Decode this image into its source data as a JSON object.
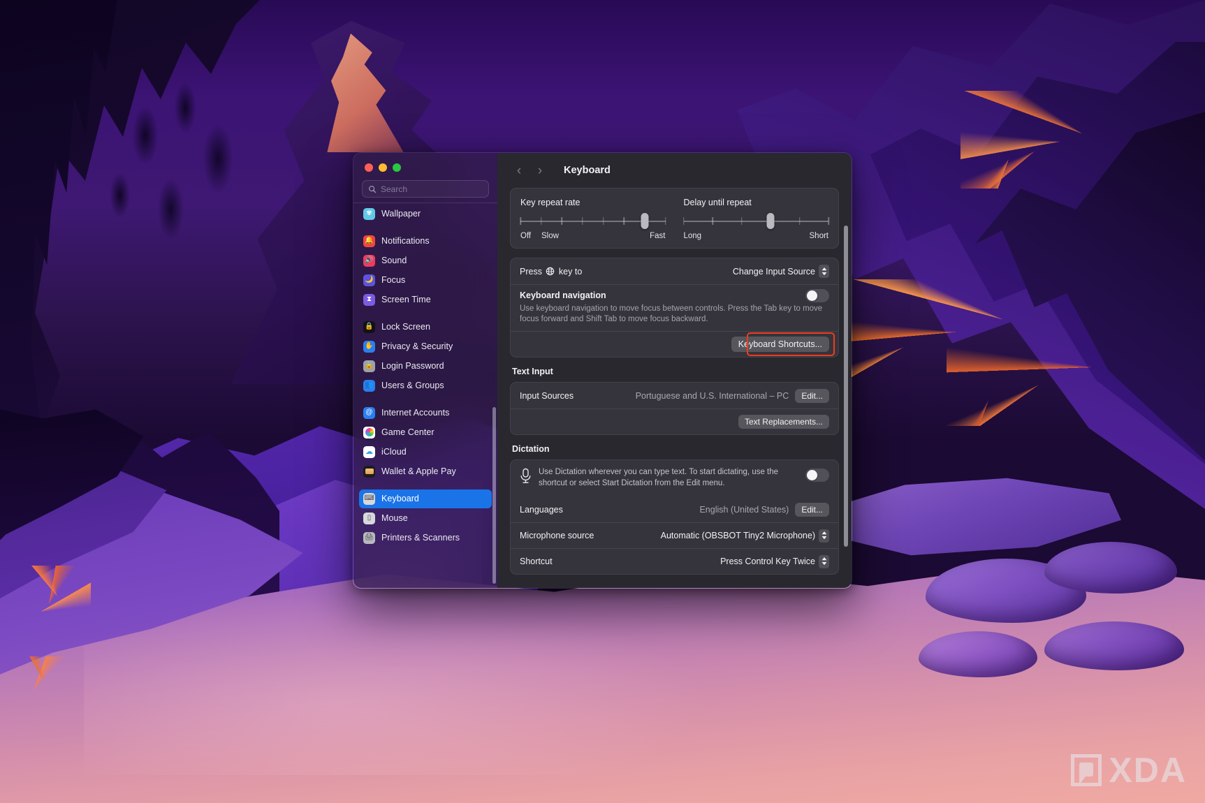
{
  "window": {
    "title": "Keyboard",
    "traffic_lights": [
      "close",
      "minimize",
      "zoom"
    ],
    "nav_back": "‹",
    "nav_forward": "›"
  },
  "search": {
    "placeholder": "Search",
    "value": "",
    "icon": "search-icon"
  },
  "sidebar": {
    "items": [
      {
        "label": "Wallpaper",
        "icon": "wallpaper-icon",
        "color": "#62c8e8",
        "glyph": "✾",
        "selected": false,
        "gap_after": true
      },
      {
        "label": "Notifications",
        "icon": "notifications-icon",
        "color": "#f0453f",
        "glyph": "🔔",
        "selected": false,
        "gap_after": false
      },
      {
        "label": "Sound",
        "icon": "sound-icon",
        "color": "#ef3b5b",
        "glyph": "🔊",
        "selected": false,
        "gap_after": false
      },
      {
        "label": "Focus",
        "icon": "focus-icon",
        "color": "#5a54de",
        "glyph": "🌙",
        "selected": false,
        "gap_after": false
      },
      {
        "label": "Screen Time",
        "icon": "screen-time-icon",
        "color": "#7b5ce0",
        "glyph": "⧗",
        "selected": false,
        "gap_after": true
      },
      {
        "label": "Lock Screen",
        "icon": "lock-screen-icon",
        "color": "#121214",
        "glyph": "🔒",
        "selected": false,
        "gap_after": false
      },
      {
        "label": "Privacy & Security",
        "icon": "privacy-security-icon",
        "color": "#2b7ef0",
        "glyph": "✋",
        "selected": false,
        "gap_after": false
      },
      {
        "label": "Login Password",
        "icon": "login-password-icon",
        "color": "#a0a0a6",
        "glyph": "🔒",
        "selected": false,
        "gap_after": false
      },
      {
        "label": "Users & Groups",
        "icon": "users-groups-icon",
        "color": "#2b7ef0",
        "glyph": "👥",
        "selected": false,
        "gap_after": true
      },
      {
        "label": "Internet Accounts",
        "icon": "internet-accounts-icon",
        "color": "#2b7ef0",
        "glyph": "@",
        "selected": false,
        "gap_after": false
      },
      {
        "label": "Game Center",
        "icon": "game-center-icon",
        "color": "#ffffff",
        "glyph": "◕",
        "selected": false,
        "gap_after": false
      },
      {
        "label": "iCloud",
        "icon": "icloud-icon",
        "color": "#ffffff",
        "glyph": "☁",
        "selected": false,
        "gap_after": false
      },
      {
        "label": "Wallet & Apple Pay",
        "icon": "wallet-apple-pay-icon",
        "color": "#1c1c1e",
        "glyph": "▤",
        "selected": false,
        "gap_after": true
      },
      {
        "label": "Keyboard",
        "icon": "keyboard-icon",
        "color": "#d8d8dc",
        "glyph": "⌨",
        "selected": true,
        "gap_after": false
      },
      {
        "label": "Mouse",
        "icon": "mouse-icon",
        "color": "#d8d8dc",
        "glyph": "▯",
        "selected": false,
        "gap_after": false
      },
      {
        "label": "Printers & Scanners",
        "icon": "printers-scanners-icon",
        "color": "#b8b8be",
        "glyph": "🖨",
        "selected": false,
        "gap_after": false
      }
    ]
  },
  "main": {
    "key_repeat": {
      "title": "Key repeat rate",
      "ticks": 8,
      "thumb_index": 6,
      "legend_left": "Off",
      "legend_second": "Slow",
      "legend_right": "Fast"
    },
    "delay_repeat": {
      "title": "Delay until repeat",
      "ticks": 6,
      "thumb_index": 3,
      "legend_left": "Long",
      "legend_right": "Short"
    },
    "press_key": {
      "label_prefix": "Press",
      "label_suffix": "key to",
      "globe_icon": "globe-icon",
      "value": "Change Input Source"
    },
    "keyboard_navigation": {
      "label": "Keyboard navigation",
      "description": "Use keyboard navigation to move focus between controls. Press the Tab key to move focus forward and Shift Tab to move focus backward.",
      "enabled": false
    },
    "keyboard_shortcuts_button": "Keyboard Shortcuts...",
    "highlight_color": "#f03c1e",
    "text_input": {
      "heading": "Text Input",
      "input_sources_label": "Input Sources",
      "input_sources_value": "Portuguese and U.S. International – PC",
      "edit_button": "Edit...",
      "text_replacements_button": "Text Replacements..."
    },
    "dictation": {
      "heading": "Dictation",
      "mic_icon": "microphone-icon",
      "description": "Use Dictation wherever you can type text. To start dictating, use the shortcut or select Start Dictation from the Edit menu.",
      "enabled": false,
      "languages_label": "Languages",
      "languages_value": "English (United States)",
      "languages_edit_button": "Edit...",
      "mic_source_label": "Microphone source",
      "mic_source_value": "Automatic (OBSBOT Tiny2 Microphone)",
      "shortcut_label": "Shortcut",
      "shortcut_value": "Press Control Key Twice"
    }
  },
  "watermark": {
    "text": "XDA"
  }
}
